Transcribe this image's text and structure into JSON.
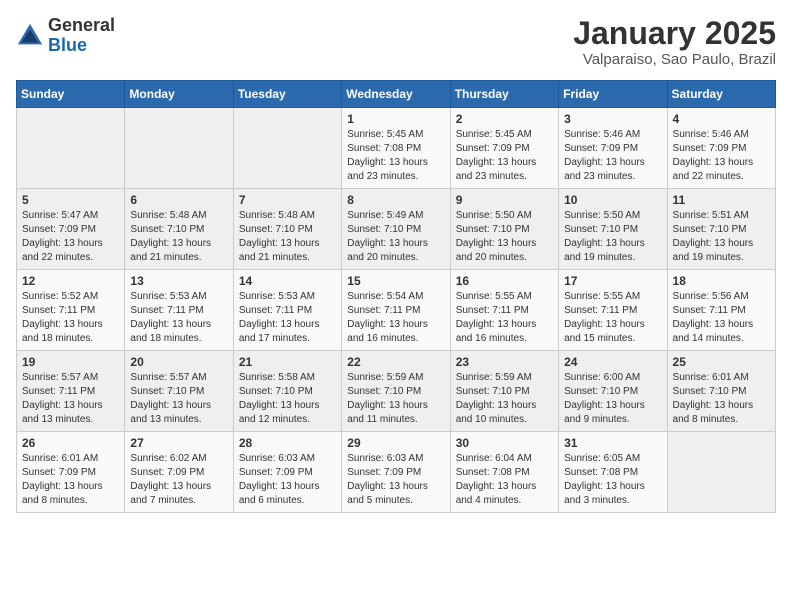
{
  "header": {
    "logo_general": "General",
    "logo_blue": "Blue",
    "month_title": "January 2025",
    "location": "Valparaiso, Sao Paulo, Brazil"
  },
  "weekdays": [
    "Sunday",
    "Monday",
    "Tuesday",
    "Wednesday",
    "Thursday",
    "Friday",
    "Saturday"
  ],
  "weeks": [
    [
      {
        "day": "",
        "content": ""
      },
      {
        "day": "",
        "content": ""
      },
      {
        "day": "",
        "content": ""
      },
      {
        "day": "1",
        "content": "Sunrise: 5:45 AM\nSunset: 7:08 PM\nDaylight: 13 hours and 23 minutes."
      },
      {
        "day": "2",
        "content": "Sunrise: 5:45 AM\nSunset: 7:09 PM\nDaylight: 13 hours and 23 minutes."
      },
      {
        "day": "3",
        "content": "Sunrise: 5:46 AM\nSunset: 7:09 PM\nDaylight: 13 hours and 23 minutes."
      },
      {
        "day": "4",
        "content": "Sunrise: 5:46 AM\nSunset: 7:09 PM\nDaylight: 13 hours and 22 minutes."
      }
    ],
    [
      {
        "day": "5",
        "content": "Sunrise: 5:47 AM\nSunset: 7:09 PM\nDaylight: 13 hours and 22 minutes."
      },
      {
        "day": "6",
        "content": "Sunrise: 5:48 AM\nSunset: 7:10 PM\nDaylight: 13 hours and 21 minutes."
      },
      {
        "day": "7",
        "content": "Sunrise: 5:48 AM\nSunset: 7:10 PM\nDaylight: 13 hours and 21 minutes."
      },
      {
        "day": "8",
        "content": "Sunrise: 5:49 AM\nSunset: 7:10 PM\nDaylight: 13 hours and 20 minutes."
      },
      {
        "day": "9",
        "content": "Sunrise: 5:50 AM\nSunset: 7:10 PM\nDaylight: 13 hours and 20 minutes."
      },
      {
        "day": "10",
        "content": "Sunrise: 5:50 AM\nSunset: 7:10 PM\nDaylight: 13 hours and 19 minutes."
      },
      {
        "day": "11",
        "content": "Sunrise: 5:51 AM\nSunset: 7:10 PM\nDaylight: 13 hours and 19 minutes."
      }
    ],
    [
      {
        "day": "12",
        "content": "Sunrise: 5:52 AM\nSunset: 7:11 PM\nDaylight: 13 hours and 18 minutes."
      },
      {
        "day": "13",
        "content": "Sunrise: 5:53 AM\nSunset: 7:11 PM\nDaylight: 13 hours and 18 minutes."
      },
      {
        "day": "14",
        "content": "Sunrise: 5:53 AM\nSunset: 7:11 PM\nDaylight: 13 hours and 17 minutes."
      },
      {
        "day": "15",
        "content": "Sunrise: 5:54 AM\nSunset: 7:11 PM\nDaylight: 13 hours and 16 minutes."
      },
      {
        "day": "16",
        "content": "Sunrise: 5:55 AM\nSunset: 7:11 PM\nDaylight: 13 hours and 16 minutes."
      },
      {
        "day": "17",
        "content": "Sunrise: 5:55 AM\nSunset: 7:11 PM\nDaylight: 13 hours and 15 minutes."
      },
      {
        "day": "18",
        "content": "Sunrise: 5:56 AM\nSunset: 7:11 PM\nDaylight: 13 hours and 14 minutes."
      }
    ],
    [
      {
        "day": "19",
        "content": "Sunrise: 5:57 AM\nSunset: 7:11 PM\nDaylight: 13 hours and 13 minutes."
      },
      {
        "day": "20",
        "content": "Sunrise: 5:57 AM\nSunset: 7:10 PM\nDaylight: 13 hours and 13 minutes."
      },
      {
        "day": "21",
        "content": "Sunrise: 5:58 AM\nSunset: 7:10 PM\nDaylight: 13 hours and 12 minutes."
      },
      {
        "day": "22",
        "content": "Sunrise: 5:59 AM\nSunset: 7:10 PM\nDaylight: 13 hours and 11 minutes."
      },
      {
        "day": "23",
        "content": "Sunrise: 5:59 AM\nSunset: 7:10 PM\nDaylight: 13 hours and 10 minutes."
      },
      {
        "day": "24",
        "content": "Sunrise: 6:00 AM\nSunset: 7:10 PM\nDaylight: 13 hours and 9 minutes."
      },
      {
        "day": "25",
        "content": "Sunrise: 6:01 AM\nSunset: 7:10 PM\nDaylight: 13 hours and 8 minutes."
      }
    ],
    [
      {
        "day": "26",
        "content": "Sunrise: 6:01 AM\nSunset: 7:09 PM\nDaylight: 13 hours and 8 minutes."
      },
      {
        "day": "27",
        "content": "Sunrise: 6:02 AM\nSunset: 7:09 PM\nDaylight: 13 hours and 7 minutes."
      },
      {
        "day": "28",
        "content": "Sunrise: 6:03 AM\nSunset: 7:09 PM\nDaylight: 13 hours and 6 minutes."
      },
      {
        "day": "29",
        "content": "Sunrise: 6:03 AM\nSunset: 7:09 PM\nDaylight: 13 hours and 5 minutes."
      },
      {
        "day": "30",
        "content": "Sunrise: 6:04 AM\nSunset: 7:08 PM\nDaylight: 13 hours and 4 minutes."
      },
      {
        "day": "31",
        "content": "Sunrise: 6:05 AM\nSunset: 7:08 PM\nDaylight: 13 hours and 3 minutes."
      },
      {
        "day": "",
        "content": ""
      }
    ]
  ]
}
